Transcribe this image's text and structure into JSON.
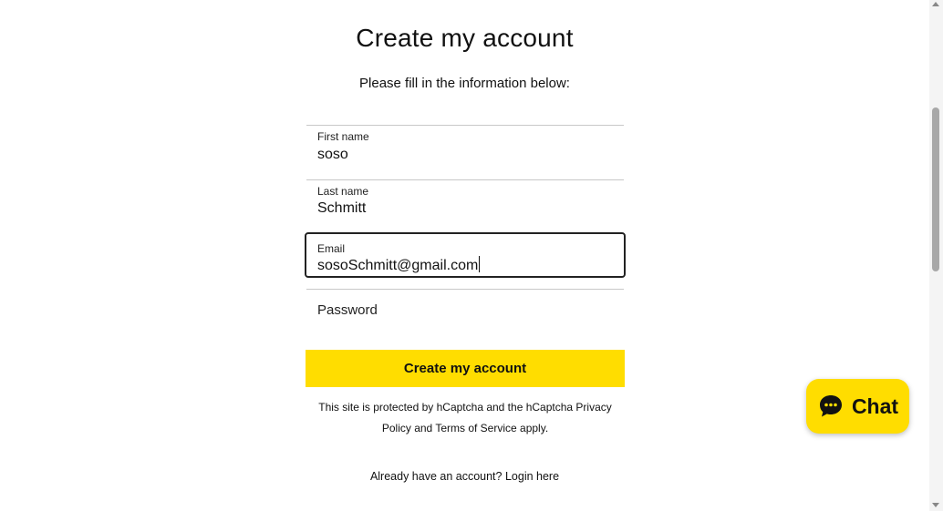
{
  "page": {
    "title": "Create my account",
    "subtitle": "Please fill in the information below:"
  },
  "form": {
    "first_name": {
      "label": "First name",
      "value": "soso"
    },
    "last_name": {
      "label": "Last name",
      "value": "Schmitt"
    },
    "email": {
      "label": "Email",
      "value": "sosoSchmitt@gmail.com"
    },
    "password": {
      "placeholder": "Password"
    },
    "submit_label": "Create my account"
  },
  "captcha_notice": "This site is protected by hCaptcha and the hCaptcha Privacy Policy and Terms of Service apply.",
  "login": {
    "prompt": "Already have an account?",
    "link_label": "Login here"
  },
  "chat_widget": {
    "label": "Chat",
    "icon": "chat-bubble-icon",
    "color": "#ffdd00"
  },
  "colors": {
    "accent": "#ffdd00"
  }
}
